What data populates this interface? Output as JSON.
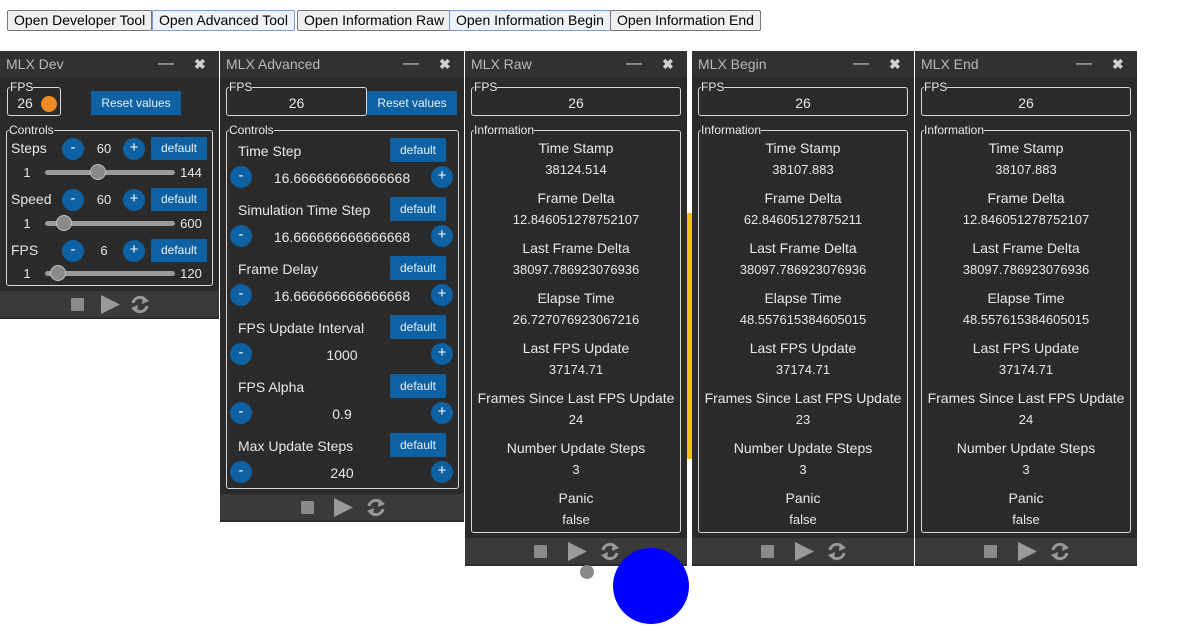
{
  "toolbar": {
    "buttons": [
      "Open Developer Tool",
      "Open Advanced Tool",
      "Open Information Raw",
      "Open Information Begin",
      "Open Information End"
    ]
  },
  "colors": {
    "panel_bg": "#2b2b2b",
    "title_bg": "#323232",
    "accent_blue": "#0e62a3",
    "fps_dot": "#f08a24",
    "yellow_bar": "#f5c400",
    "circle_blue": "#0000ff"
  },
  "dev": {
    "title": "MLX Dev",
    "fps_legend": "FPS",
    "fps": "26",
    "reset": "Reset values",
    "controls_legend": "Controls",
    "controls": [
      {
        "label": "Steps",
        "value": "60",
        "min": "1",
        "max": "144",
        "default": "default",
        "fraction": 0.42
      },
      {
        "label": "Speed",
        "value": "60",
        "min": "1",
        "max": "600",
        "default": "default",
        "fraction": 0.1
      },
      {
        "label": "FPS",
        "value": "6",
        "min": "1",
        "max": "120",
        "default": "default",
        "fraction": 0.04
      }
    ]
  },
  "advanced": {
    "title": "MLX Advanced",
    "fps_legend": "FPS",
    "fps": "26",
    "reset": "Reset values",
    "controls_legend": "Controls",
    "controls": [
      {
        "label": "Time Step",
        "value": "16.666666666666668",
        "default": "default"
      },
      {
        "label": "Simulation Time Step",
        "value": "16.666666666666668",
        "default": "default"
      },
      {
        "label": "Frame Delay",
        "value": "16.666666666666668",
        "default": "default"
      },
      {
        "label": "FPS Update Interval",
        "value": "1000",
        "default": "default"
      },
      {
        "label": "FPS Alpha",
        "value": "0.9",
        "default": "default"
      },
      {
        "label": "Max Update Steps",
        "value": "240",
        "default": "default"
      }
    ]
  },
  "info_keys": [
    "Time Stamp",
    "Frame Delta",
    "Last Frame Delta",
    "Elapse Time",
    "Last FPS Update",
    "Frames Since Last FPS Update",
    "Number Update Steps",
    "Panic"
  ],
  "raw": {
    "title": "MLX Raw",
    "fps_legend": "FPS",
    "fps": "26",
    "info_legend": "Information",
    "values": [
      "38124.514",
      "12.846051278752107",
      "38097.786923076936",
      "26.727076923067216",
      "37174.71",
      "24",
      "3",
      "false"
    ]
  },
  "begin": {
    "title": "MLX Begin",
    "fps_legend": "FPS",
    "fps": "26",
    "info_legend": "Information",
    "values": [
      "38107.883",
      "62.84605127875211",
      "38097.786923076936",
      "48.557615384605015",
      "37174.71",
      "23",
      "3",
      "false"
    ]
  },
  "end": {
    "title": "MLX End",
    "fps_legend": "FPS",
    "fps": "26",
    "info_legend": "Information",
    "values": [
      "38107.883",
      "12.846051278752107",
      "38097.786923076936",
      "48.557615384605015",
      "37174.71",
      "24",
      "3",
      "false"
    ]
  },
  "window_controls": {
    "minimize": "—",
    "close": "✖"
  },
  "player_icons": [
    "stop-icon",
    "play-icon",
    "refresh-icon"
  ]
}
